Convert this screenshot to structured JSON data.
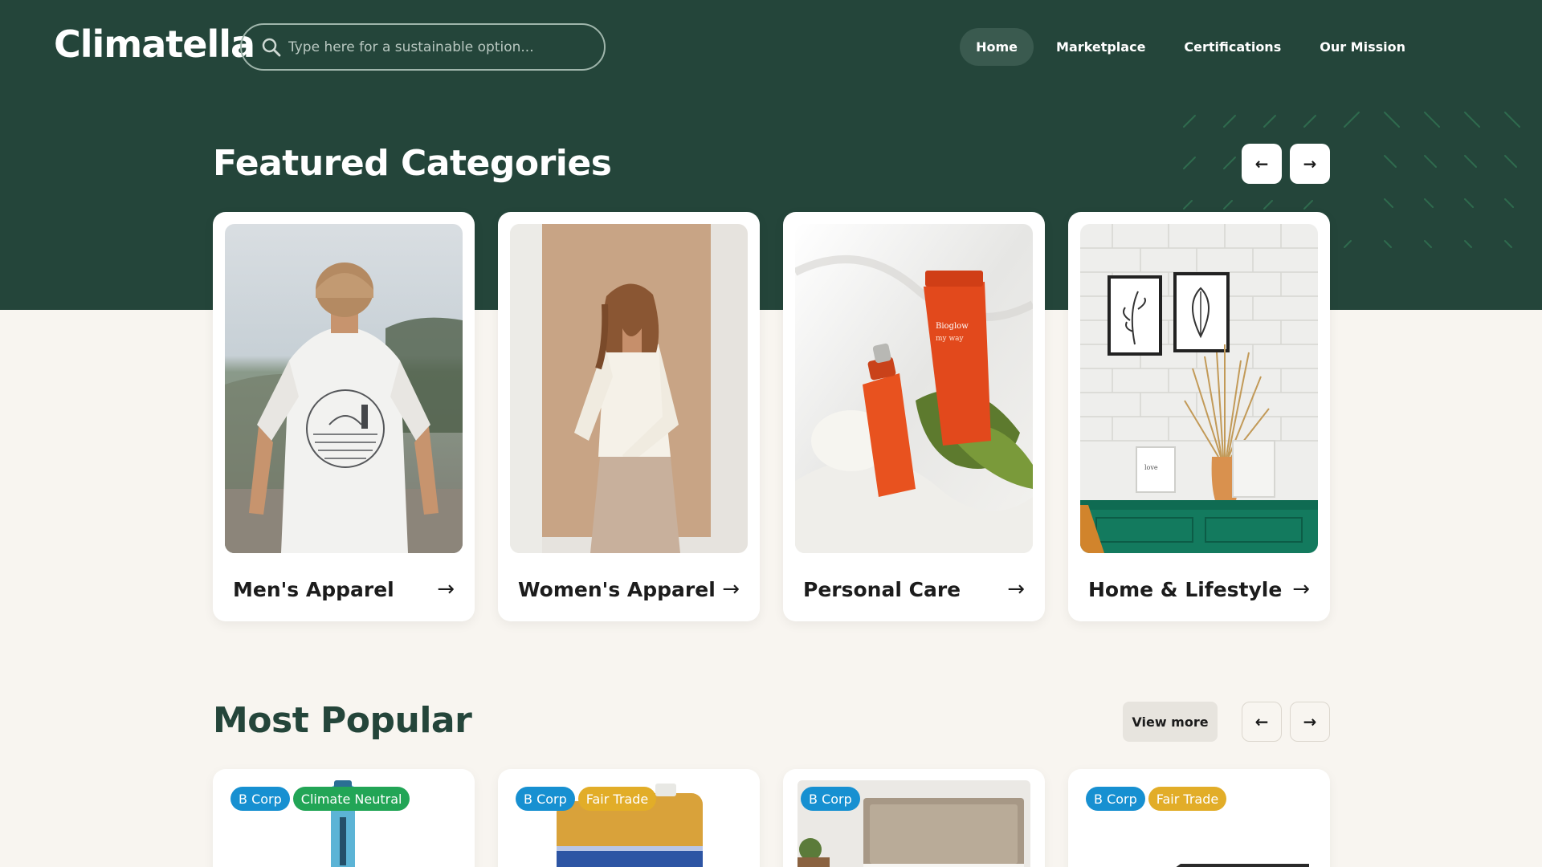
{
  "header": {
    "logo": "Climatella",
    "search_placeholder": "Type here for a sustainable option...",
    "nav": [
      "Home",
      "Marketplace",
      "Certifications",
      "Our Mission"
    ],
    "active_nav": "Home"
  },
  "featured": {
    "title": "Featured Categories",
    "prev_arrow": "←",
    "next_arrow": "→",
    "categories": [
      {
        "label": "Men's Apparel",
        "arrow": "→"
      },
      {
        "label": "Women's Apparel",
        "arrow": "→"
      },
      {
        "label": "Personal Care",
        "arrow": "→"
      },
      {
        "label": "Home & Lifestyle",
        "arrow": "→"
      }
    ]
  },
  "popular": {
    "title": "Most Popular",
    "view_more": "View more",
    "prev_arrow": "←",
    "next_arrow": "→",
    "products": [
      {
        "badges": [
          "B Corp",
          "Climate Neutral"
        ]
      },
      {
        "badges": [
          "B Corp",
          "Fair Trade"
        ]
      },
      {
        "badges": [
          "B Corp"
        ]
      },
      {
        "badges": [
          "B Corp",
          "Fair Trade"
        ]
      }
    ]
  },
  "colors": {
    "hero_green": "#24453a",
    "page_bg": "#f8f5f0",
    "bcorp": "#1790d1",
    "climate_neutral": "#22a556",
    "fair_trade": "#e2ad28"
  }
}
